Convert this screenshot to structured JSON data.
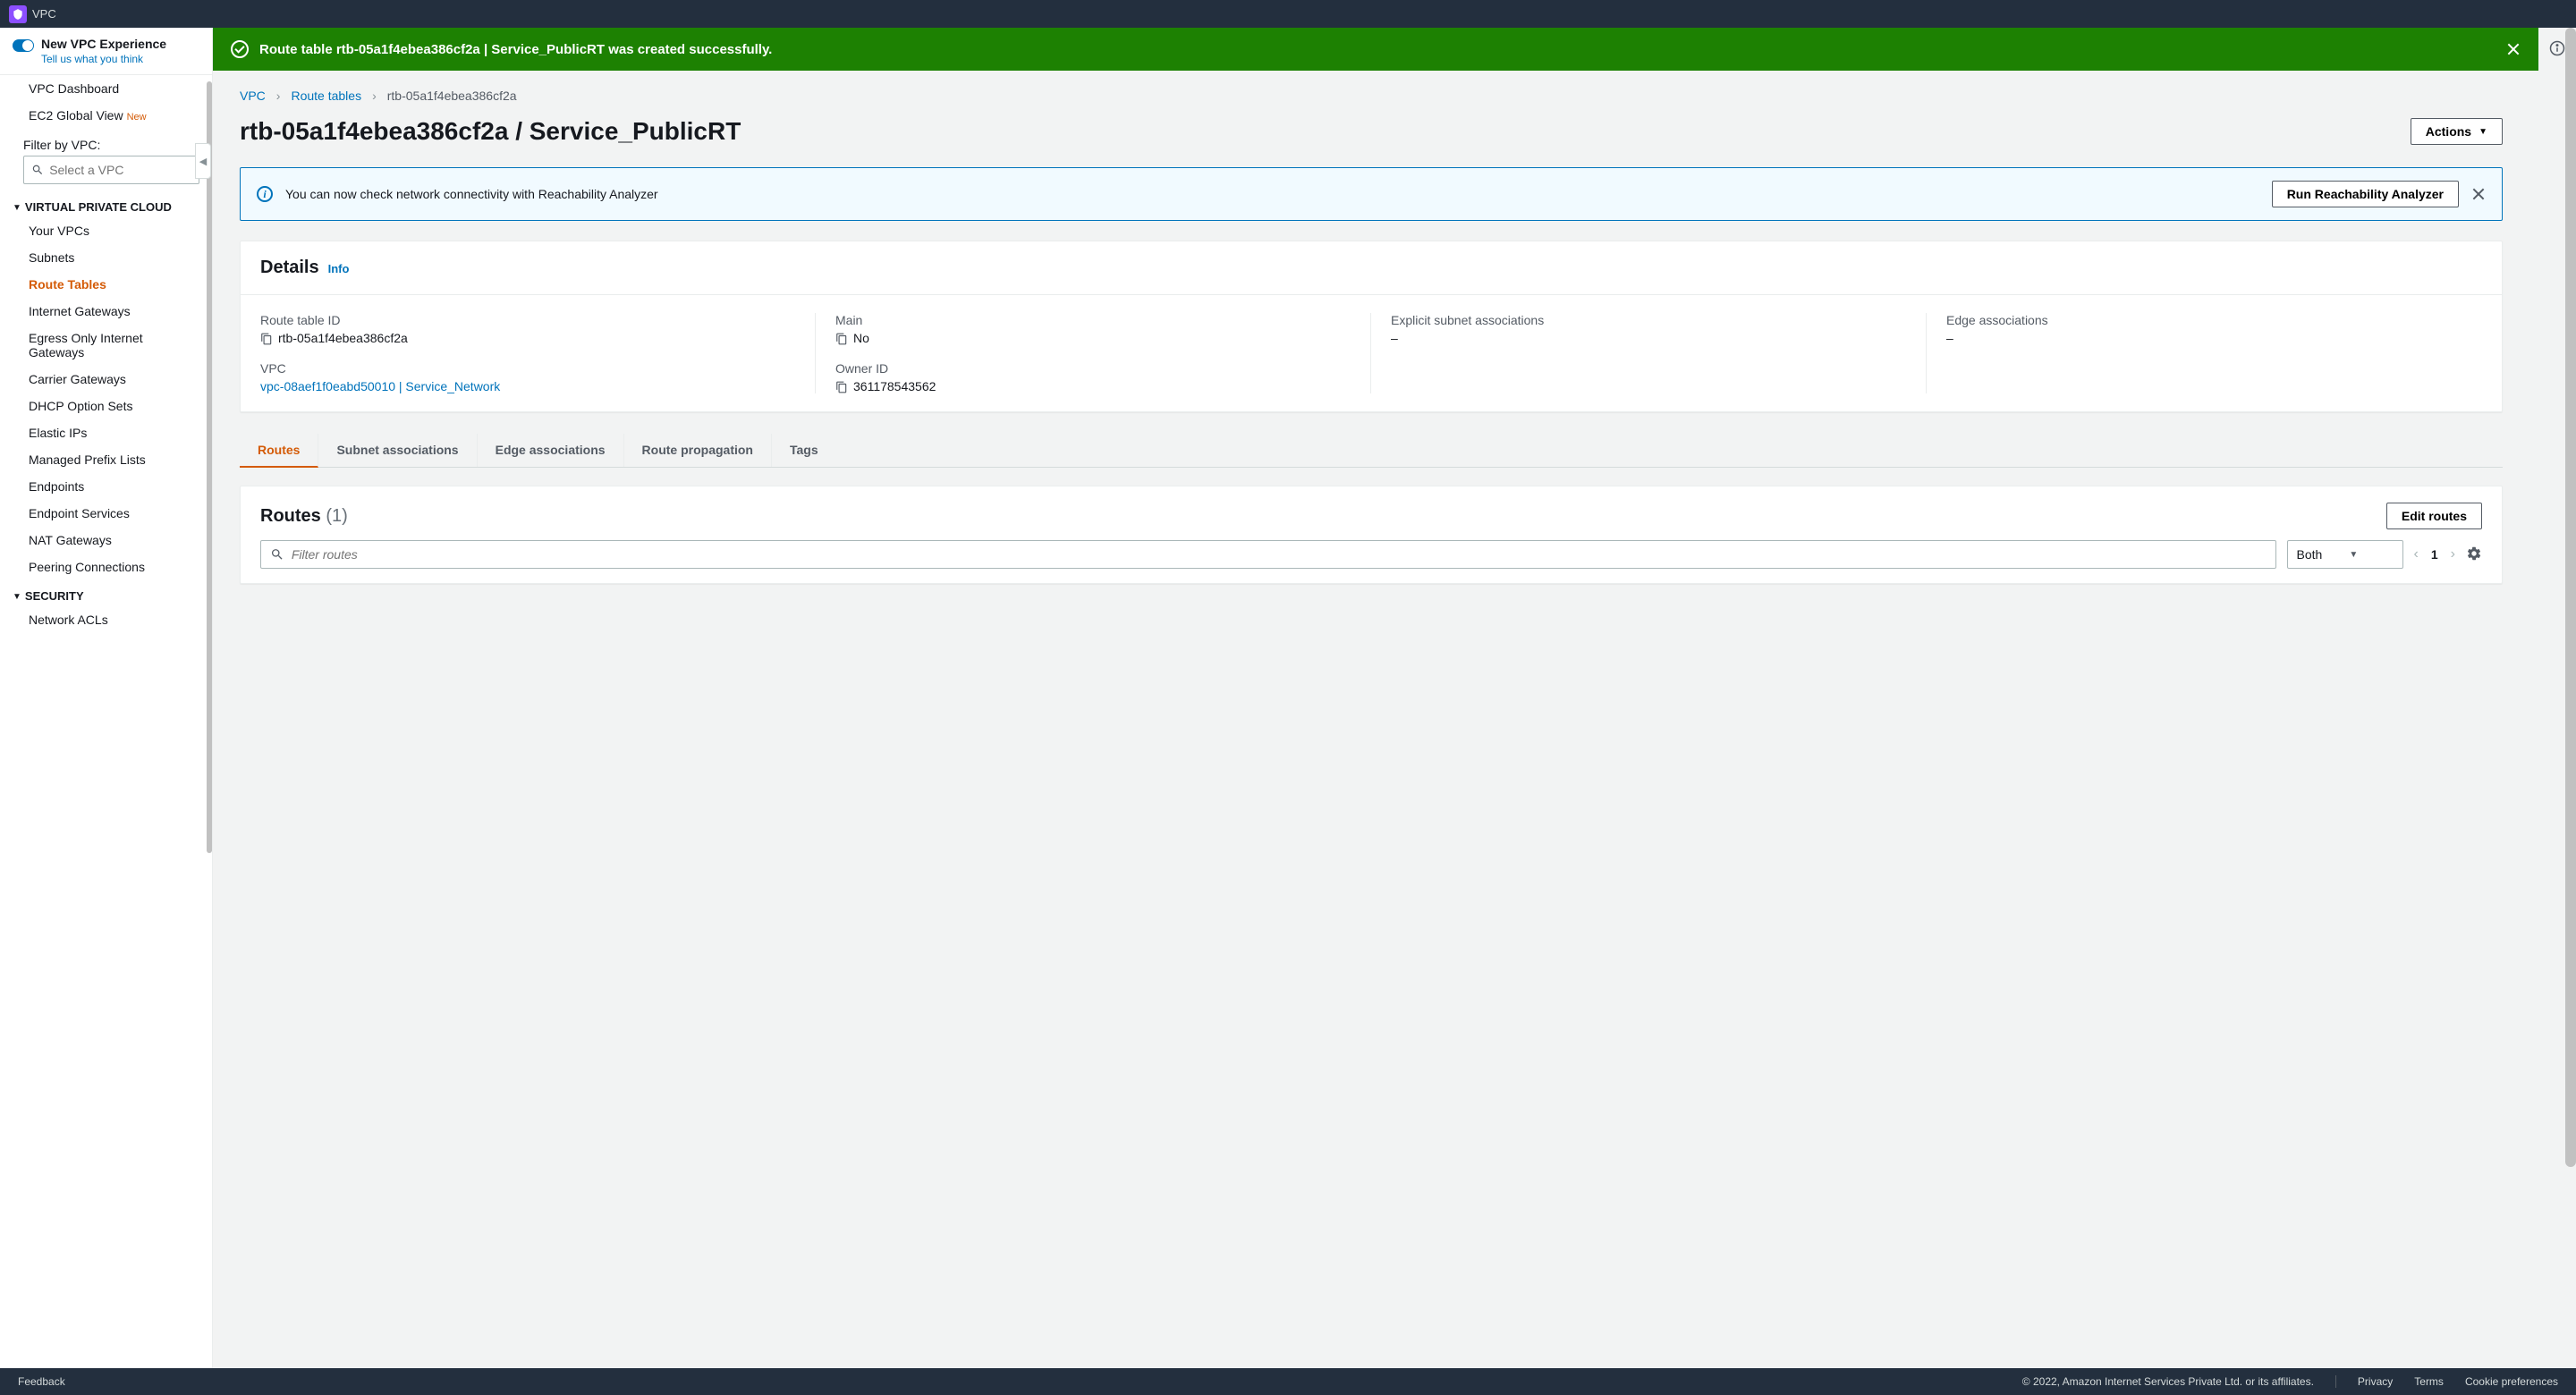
{
  "topbar": {
    "service": "VPC"
  },
  "sidebar": {
    "newExp": {
      "title": "New VPC Experience",
      "link": "Tell us what you think"
    },
    "dashboard": "VPC Dashboard",
    "globalView": "EC2 Global View",
    "globalViewBadge": "New",
    "filterLabel": "Filter by VPC:",
    "filterPlaceholder": "Select a VPC",
    "section1": "VIRTUAL PRIVATE CLOUD",
    "items1": [
      "Your VPCs",
      "Subnets",
      "Route Tables",
      "Internet Gateways",
      "Egress Only Internet Gateways",
      "Carrier Gateways",
      "DHCP Option Sets",
      "Elastic IPs",
      "Managed Prefix Lists",
      "Endpoints",
      "Endpoint Services",
      "NAT Gateways",
      "Peering Connections"
    ],
    "section2": "SECURITY",
    "items2": [
      "Network ACLs"
    ]
  },
  "banner": {
    "text": "Route table rtb-05a1f4ebea386cf2a | Service_PublicRT was created successfully."
  },
  "breadcrumb": {
    "a": "VPC",
    "b": "Route tables",
    "c": "rtb-05a1f4ebea386cf2a"
  },
  "pageTitle": "rtb-05a1f4ebea386cf2a / Service_PublicRT",
  "actionsBtn": "Actions",
  "reachability": {
    "text": "You can now check network connectivity with Reachability Analyzer",
    "btn": "Run Reachability Analyzer"
  },
  "detailsPanel": {
    "title": "Details",
    "info": "Info",
    "fields": {
      "routeTableIdLabel": "Route table ID",
      "routeTableId": "rtb-05a1f4ebea386cf2a",
      "vpcLabel": "VPC",
      "vpcLink": "vpc-08aef1f0eabd50010 | Service_Network",
      "mainLabel": "Main",
      "main": "No",
      "ownerLabel": "Owner ID",
      "owner": "361178543562",
      "explicitLabel": "Explicit subnet associations",
      "explicit": "–",
      "edgeLabel": "Edge associations",
      "edge": "–"
    }
  },
  "tabs": [
    "Routes",
    "Subnet associations",
    "Edge associations",
    "Route propagation",
    "Tags"
  ],
  "routesPanel": {
    "title": "Routes",
    "count": "(1)",
    "editBtn": "Edit routes",
    "filterPlaceholder": "Filter routes",
    "dropdown": "Both",
    "page": "1"
  },
  "footer": {
    "feedback": "Feedback",
    "copyright": "© 2022, Amazon Internet Services Private Ltd. or its affiliates.",
    "privacy": "Privacy",
    "terms": "Terms",
    "cookies": "Cookie preferences"
  }
}
